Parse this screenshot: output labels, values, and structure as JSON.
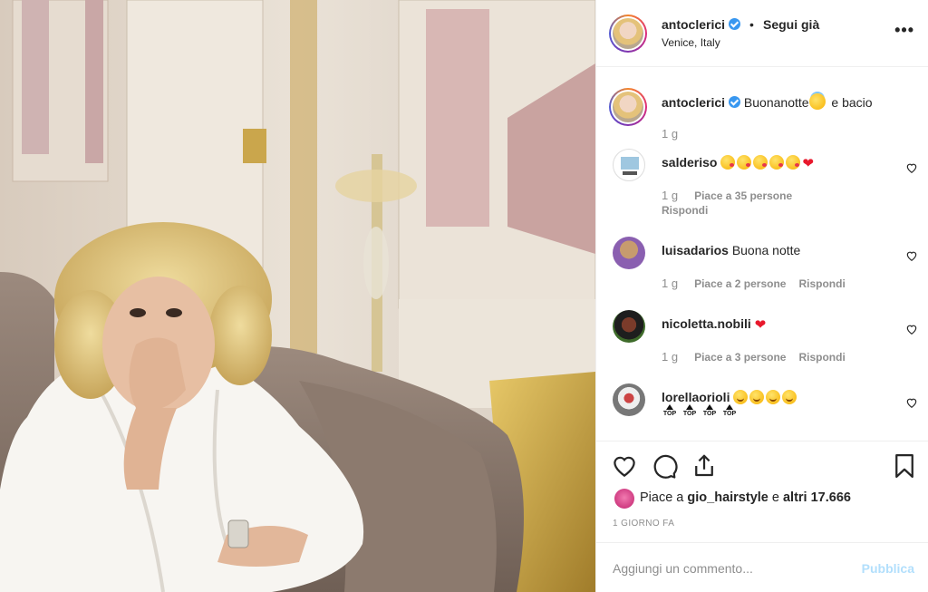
{
  "post": {
    "username": "antoclerici",
    "follow_dot": "•",
    "follow_status": "Segui già",
    "location": "Venice, Italy",
    "more": "•••"
  },
  "caption": {
    "username": "antoclerici",
    "text_before": "Buonanotte",
    "text_after": " e bacio",
    "time": "1 g"
  },
  "comments": [
    {
      "username": "salderiso",
      "text": "",
      "emojis": [
        "kiss-emoji",
        "kiss-emoji",
        "kiss-emoji",
        "kiss-emoji",
        "kiss-emoji",
        "red-heart-emoji"
      ],
      "time": "1 g",
      "likes": "Piace a 35 persone",
      "reply": "Rispondi"
    },
    {
      "username": "luisadarios",
      "text": "Buona notte",
      "time": "1 g",
      "likes": "Piace a 2 persone",
      "reply": "Rispondi"
    },
    {
      "username": "nicoletta.nobili",
      "text": "",
      "emojis": [
        "red-heart-emoji"
      ],
      "time": "1 g",
      "likes": "Piace a 3 persone",
      "reply": "Rispondi"
    },
    {
      "username": "lorellaorioli",
      "text": "",
      "emojis": [
        "smile-emoji",
        "smile-emoji",
        "smile-emoji",
        "smile-emoji"
      ],
      "top_labels": [
        "TOP",
        "TOP",
        "TOP",
        "TOP"
      ]
    }
  ],
  "likes": {
    "prefix": "Piace a ",
    "user": "gio_hairstyle",
    "middle": " e ",
    "others": "altri 17.666"
  },
  "posted": "1 GIORNO FA",
  "add_comment": {
    "placeholder": "Aggiungi un commento...",
    "publish": "Pubblica"
  },
  "colors": {
    "verified": "#3897f0",
    "publish_disabled": "#b2dffc",
    "heart": "#e8182c",
    "muted": "#8e8e8e"
  }
}
